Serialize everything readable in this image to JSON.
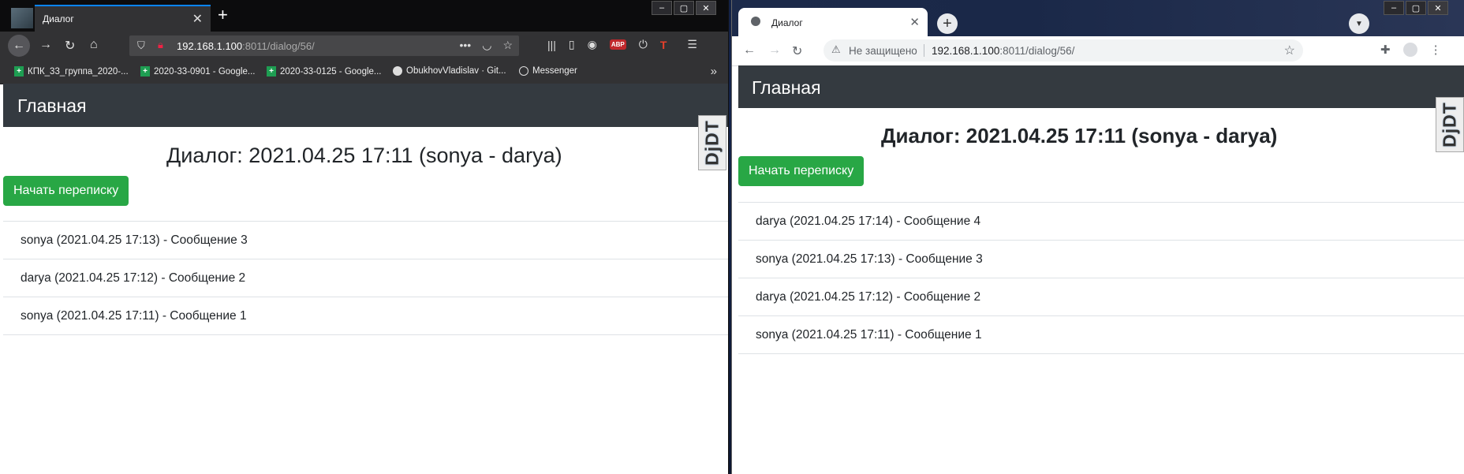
{
  "firefox": {
    "tab_title": "Диалог",
    "url_host": "192.168.1.100",
    "url_rest": ":8011/dialog/56/",
    "url_actions": "•••",
    "bookmarks": [
      {
        "label": "КПК_33_группа_2020-...",
        "icon": "green-sheet-icon"
      },
      {
        "label": "2020-33-0901 - Google...",
        "icon": "green-sheet-icon"
      },
      {
        "label": "2020-33-0125 - Google...",
        "icon": "green-sheet-icon"
      },
      {
        "label": "ObukhovVladislav · Git...",
        "icon": "github-icon"
      },
      {
        "label": "Messenger",
        "icon": "globe-icon"
      }
    ],
    "abp_label": "ABP",
    "t_label": "T",
    "page": {
      "brand": "Главная",
      "heading": "Диалог: 2021.04.25 17:11 (sonya - darya)",
      "start_button": "Начать переписку",
      "djdt": "DjDT",
      "messages": [
        "sonya (2021.04.25 17:13) - Сообщение 3",
        "darya (2021.04.25 17:12) - Сообщение 2",
        "sonya (2021.04.25 17:11) - Сообщение 1"
      ]
    }
  },
  "chrome": {
    "tab_title": "Диалог",
    "security_label": "Не защищено",
    "url_host": "192.168.1.100",
    "url_rest": ":8011/dialog/56/",
    "page": {
      "brand": "Главная",
      "heading": "Диалог: 2021.04.25 17:11 (sonya - darya)",
      "start_button": "Начать переписку",
      "djdt": "DjDT",
      "messages": [
        "darya (2021.04.25 17:14) - Сообщение 4",
        "sonya (2021.04.25 17:13) - Сообщение 3",
        "darya (2021.04.25 17:12) - Сообщение 2",
        "sonya (2021.04.25 17:11) - Сообщение 1"
      ]
    }
  },
  "colors": {
    "navbar_dark": "#343a40",
    "success_green": "#28a745",
    "firefox_accent": "#0a84ff"
  }
}
